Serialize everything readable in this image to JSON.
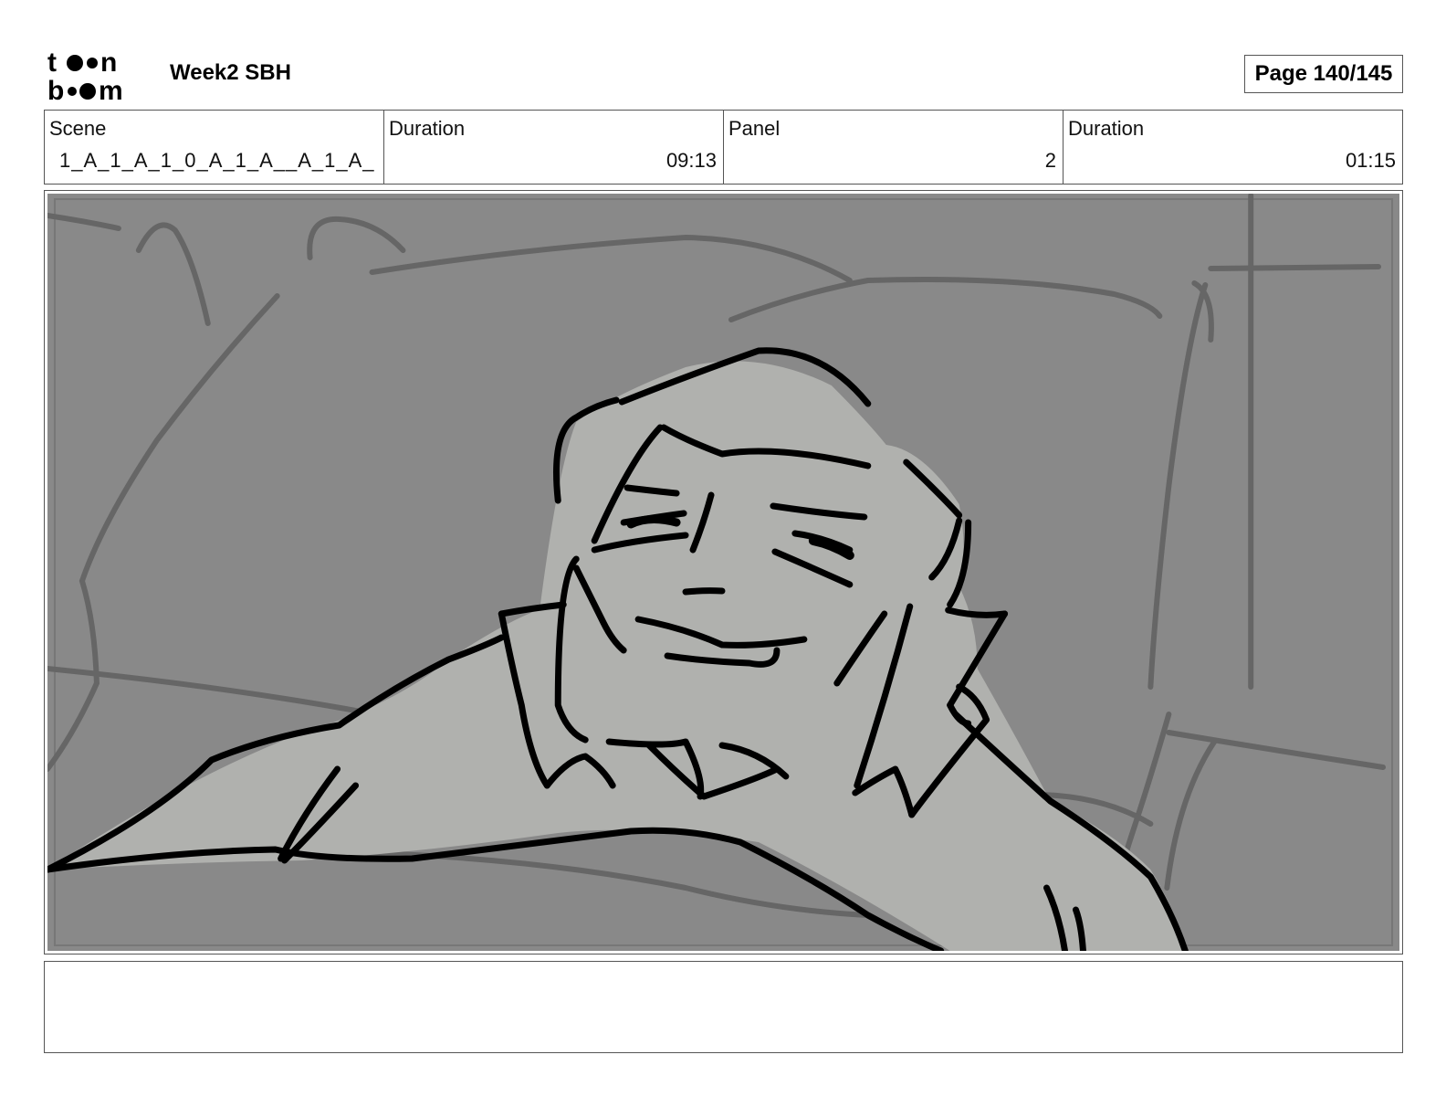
{
  "header": {
    "logo_name": "toon boom",
    "project_title": "Week2 SBH",
    "page_label": "Page 140/145"
  },
  "info": {
    "scene_label": "Scene",
    "scene_value": "1_A_1_A_1_0_A_1_A__A_1_A_",
    "scene_duration_label": "Duration",
    "scene_duration_value": "09:13",
    "panel_label": "Panel",
    "panel_value": "2",
    "panel_duration_label": "Duration",
    "panel_duration_value": "01:15"
  },
  "notes": {
    "text": ""
  },
  "colors": {
    "background_gray": "#898989",
    "figure_gray": "#b0b1ae",
    "sketch_line": "#6a6a6a",
    "ink_line": "#000000"
  }
}
